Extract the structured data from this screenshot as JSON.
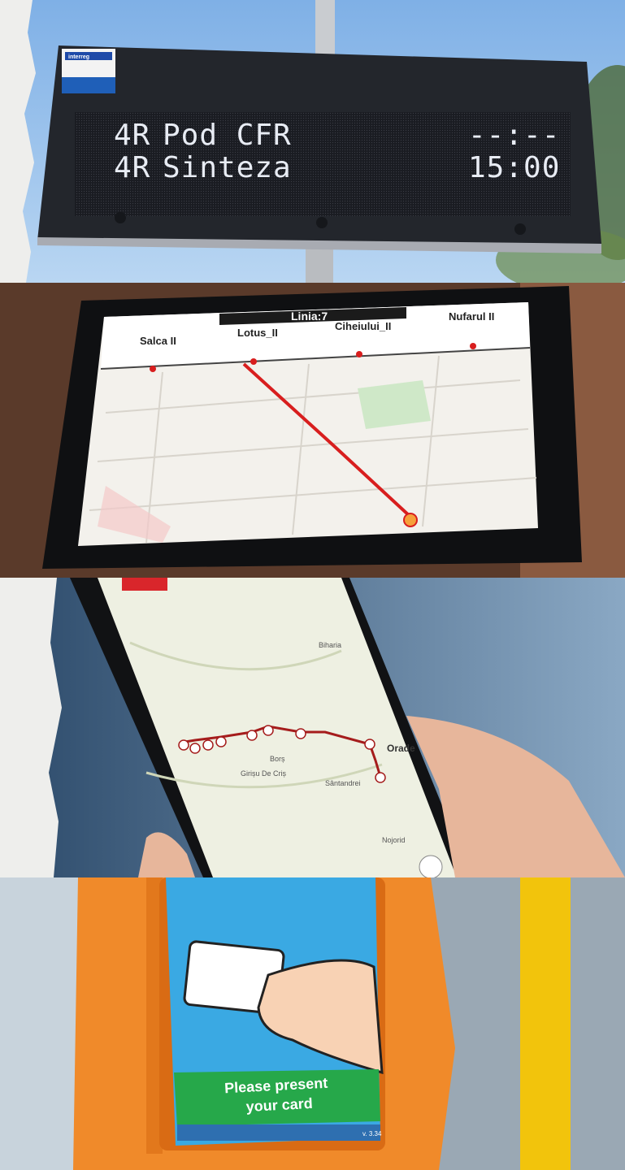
{
  "led_board": {
    "logo_text": "interreg",
    "rows": [
      {
        "route": "4R",
        "destination": "Pod CFR",
        "time": "--:--"
      },
      {
        "route": "4R",
        "destination": "Sinteza",
        "time": "15:00"
      }
    ]
  },
  "tablet": {
    "line_title": "Linia:7",
    "stops": [
      "Salca II",
      "Lotus_II",
      "Ciheiului_II",
      "Nufarul II"
    ],
    "colors": {
      "route": "#d81e1e",
      "stop_dot": "#d81e1e"
    }
  },
  "phone": {
    "map_labels": [
      "Biharia",
      "Borș",
      "Girișu De Criș",
      "Sântandrei",
      "Orade",
      "Nojorid"
    ],
    "colors": {
      "route": "#a51c1c"
    }
  },
  "validator": {
    "prompt_line1": "Please present",
    "prompt_line2": "your card",
    "version": "v. 3.34",
    "colors": {
      "body": "#f08a2a",
      "banner": "#26a84a",
      "screen": "#3aa9e3"
    }
  }
}
